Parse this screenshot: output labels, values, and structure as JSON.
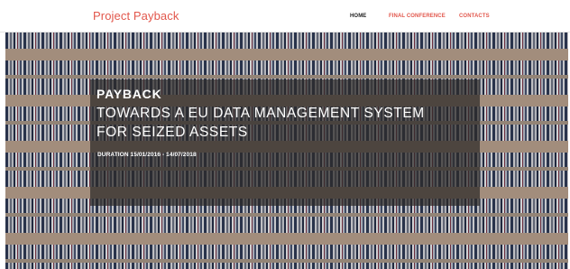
{
  "navbar": {
    "brand": "Project Payback",
    "links": [
      {
        "label": "HOME",
        "active": true
      },
      {
        "label": "FINAL CONFERENCE",
        "active": false
      },
      {
        "label": "CONTACTS",
        "active": false
      }
    ]
  },
  "hero": {
    "background": "aerial photo of parked cars",
    "title": "PAYBACK",
    "subtitle_line1": "TOWARDS A EU DATA MANAGEMENT SYSTEM",
    "subtitle_line2": "FOR SEIZED ASSETS",
    "duration": "DURATION 15/01/2016 - 14/07/2018"
  },
  "colors": {
    "brand": "#e2574c",
    "nav_active": "#222222",
    "overlay": "rgba(45,42,40,0.72)"
  }
}
